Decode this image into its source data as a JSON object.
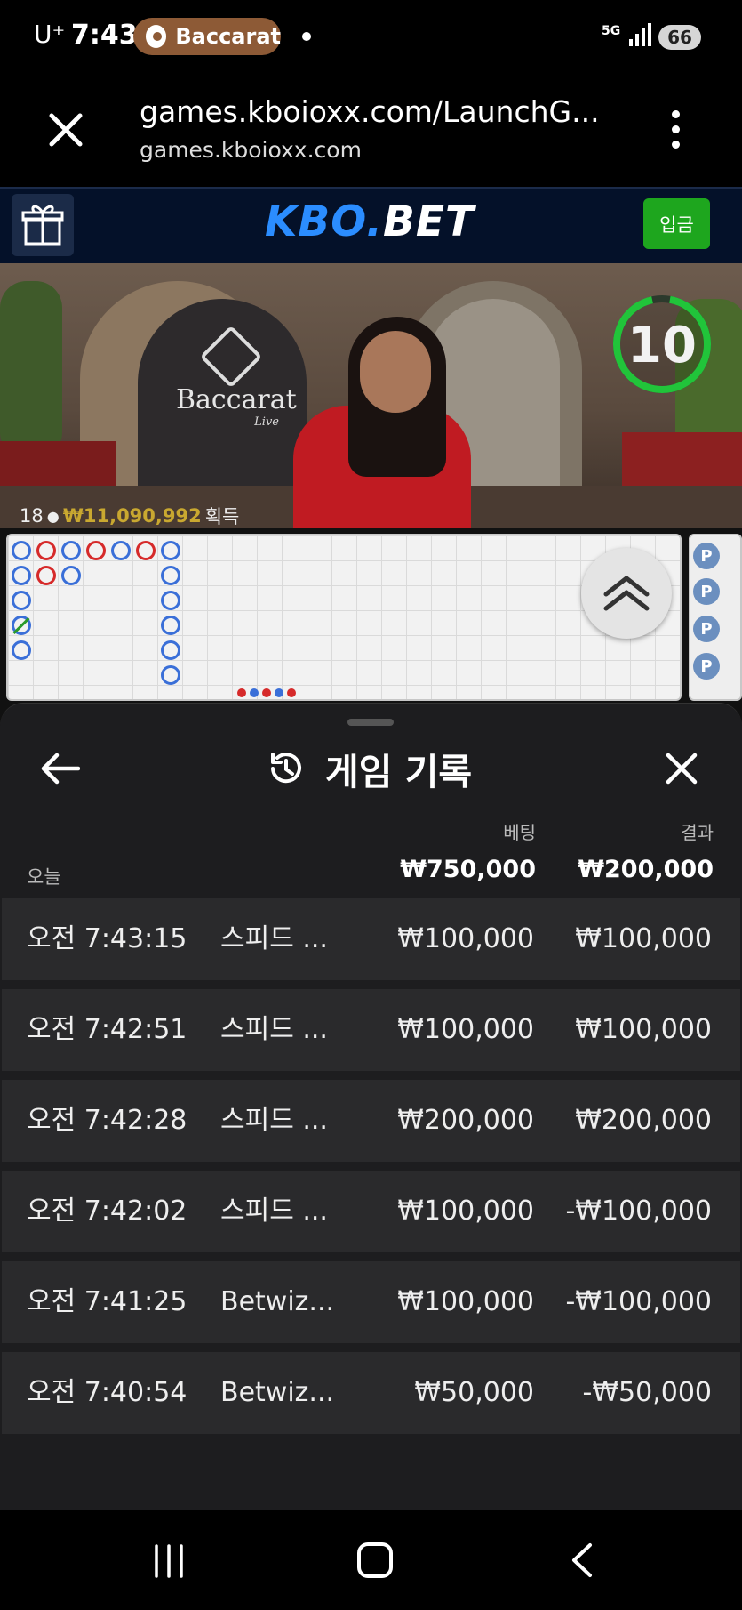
{
  "status_bar": {
    "carrier": "U⁺",
    "time": "7:43",
    "app_chip": "Baccarat",
    "network": "5G",
    "battery": "66"
  },
  "browser": {
    "url": "games.kboioxx.com/LaunchG...",
    "domain": "games.kboioxx.com"
  },
  "site": {
    "logo_part1": "KBO.",
    "logo_part2": "BET",
    "deposit_label": "입금",
    "accent_color": "#2b8dff",
    "deposit_color": "#1ea61e"
  },
  "video": {
    "brand_name": "Baccarat",
    "brand_sub": "Live",
    "countdown": "10",
    "winners_count": "18",
    "winners_amount": "₩11,090,992",
    "winners_suffix": "획득"
  },
  "roadmap": {
    "side_marker": "P"
  },
  "history": {
    "title": "게임 기록",
    "col_bet": "베팅",
    "col_result": "결과",
    "today_label": "오늘",
    "total_bet": "₩750,000",
    "total_result": "₩200,000",
    "rows": [
      {
        "time": "오전 7:43:15",
        "game": "스피드 ...",
        "bet": "₩100,000",
        "result": "₩100,000"
      },
      {
        "time": "오전 7:42:51",
        "game": "스피드 ...",
        "bet": "₩100,000",
        "result": "₩100,000"
      },
      {
        "time": "오전 7:42:28",
        "game": "스피드 ...",
        "bet": "₩200,000",
        "result": "₩200,000"
      },
      {
        "time": "오전 7:42:02",
        "game": "스피드 ...",
        "bet": "₩100,000",
        "result": "-₩100,000"
      },
      {
        "time": "오전 7:41:25",
        "game": "Betwiz...",
        "bet": "₩100,000",
        "result": "-₩100,000"
      },
      {
        "time": "오전 7:40:54",
        "game": "Betwiz...",
        "bet": "₩50,000",
        "result": "-₩50,000"
      }
    ]
  }
}
